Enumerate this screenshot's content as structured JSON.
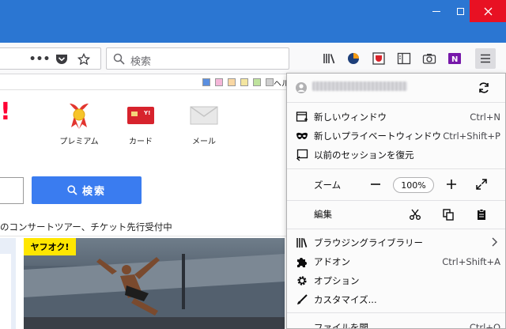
{
  "navbar": {
    "search_placeholder": "検索"
  },
  "page": {
    "help_link": "ヘル",
    "services": [
      {
        "label": "プレミアム",
        "icon": "ribbon-badge-icon"
      },
      {
        "label": "カード",
        "icon": "card-icon"
      },
      {
        "label": "メール",
        "icon": "envelope-icon"
      }
    ],
    "search_button": "検索",
    "news_text": "のコンサートツアー、チケット先行受付中",
    "banner_badge": "ヤフオク!"
  },
  "menu": {
    "account_email": "",
    "items_group1": [
      {
        "label": "新しいウィンドウ",
        "shortcut": "Ctrl+N",
        "icon": "new-window-icon"
      },
      {
        "label": "新しいプライベートウィンドウ",
        "shortcut": "Ctrl+Shift+P",
        "icon": "private-mask-icon"
      },
      {
        "label": "以前のセッションを復元",
        "shortcut": "",
        "icon": "restore-session-icon"
      }
    ],
    "zoom": {
      "label": "ズーム",
      "value": "100%"
    },
    "edit": {
      "label": "編集"
    },
    "items_group2": [
      {
        "label": "ブラウジングライブラリー",
        "shortcut": "",
        "icon": "library-icon"
      },
      {
        "label": "アドオン",
        "shortcut": "Ctrl+Shift+A",
        "icon": "puzzle-icon"
      },
      {
        "label": "オプション",
        "shortcut": "",
        "icon": "gear-icon"
      },
      {
        "label": "カスタマイズ...",
        "shortcut": "",
        "icon": "brush-icon"
      }
    ],
    "items_group3": [
      {
        "label": "ファイルを開...",
        "shortcut": "Ctrl+O"
      }
    ]
  },
  "colors": {
    "titlebar": "#2b76d2",
    "close_button": "#e81123",
    "search_button": "#3a7cf0",
    "brand_red": "#ff0033",
    "auction_yellow": "#ffe600"
  }
}
